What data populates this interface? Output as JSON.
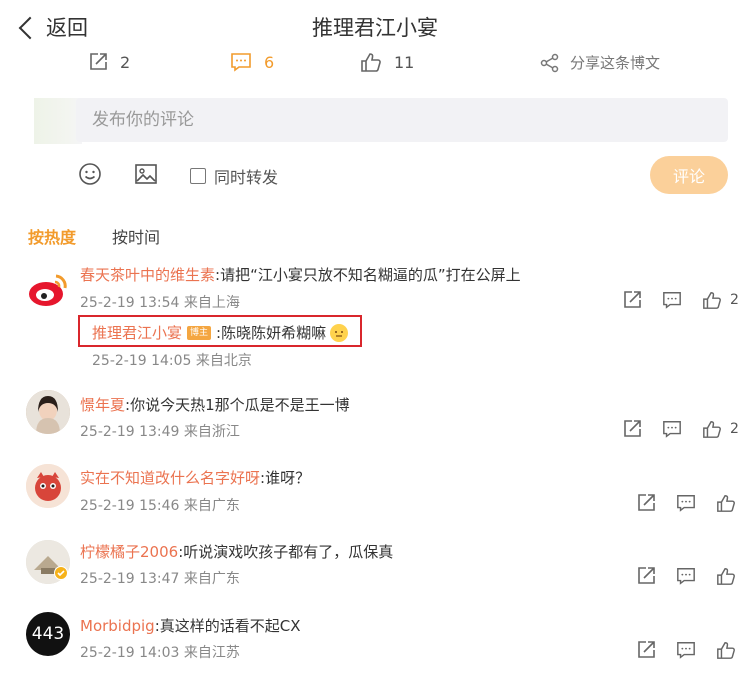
{
  "header": {
    "back_label": "返回",
    "title": "推理君江小宴"
  },
  "actions": {
    "repost_count": "2",
    "comment_count": "6",
    "like_count": "11",
    "share_label": "分享这条博文"
  },
  "compose": {
    "placeholder": "发布你的评论",
    "repost_label": "同时转发",
    "submit_label": "评论"
  },
  "sort": {
    "hot": "按热度",
    "time": "按时间"
  },
  "comments": [
    {
      "user": "春天茶叶中的维生素",
      "text": ":请把“江小宴只放不知名糊逼的瓜”打在公屏上",
      "meta": "25-2-19 13:54 来自上海",
      "likes": "2",
      "reply": {
        "user": "推理君江小宴",
        "badge": "博主",
        "text": ":陈晓陈妍希糊嘛",
        "meta": "25-2-19 14:05 来自北京"
      }
    },
    {
      "user": "憬年夏",
      "text": ":你说今天热1那个瓜是不是王一博",
      "meta": "25-2-19 13:49 来自浙江",
      "likes": "2"
    },
    {
      "user": "实在不知道改什么名字好呀",
      "text": ":谁呀？",
      "meta": "25-2-19 15:46 来自广东",
      "likes": ""
    },
    {
      "user": "柠檬橘子2006",
      "text": ":听说演戏吹孩子都有了，瓜保真",
      "meta": "25-2-19 13:47 来自广东",
      "likes": ""
    },
    {
      "user": "Morbidpig",
      "text": ":真这样的话看不起CX",
      "meta": "25-2-19 14:03 来自江苏",
      "likes": "",
      "avatar_text": "443"
    }
  ],
  "colors": {
    "accent": "#f29b2c",
    "username": "#eb7350",
    "highlight": "#d9262c"
  }
}
